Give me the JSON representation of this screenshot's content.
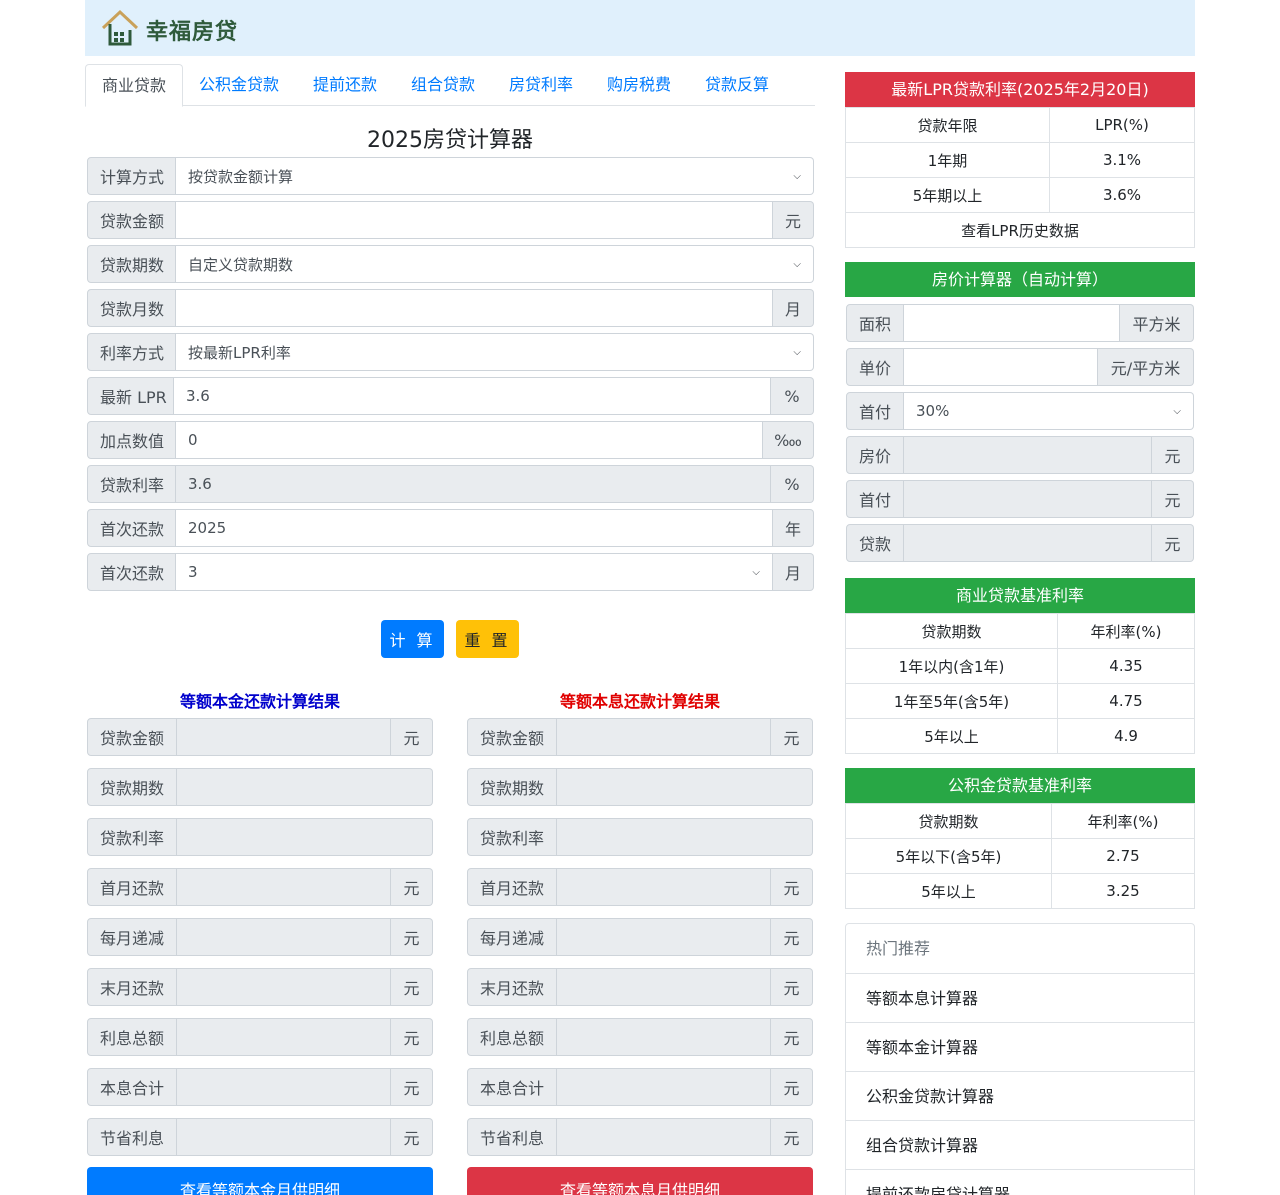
{
  "site": {
    "name": "幸福房贷"
  },
  "tabs": [
    "商业贷款",
    "公积金贷款",
    "提前还款",
    "组合贷款",
    "房贷利率",
    "购房税费",
    "贷款反算"
  ],
  "calculator": {
    "title": "2025房贷计算器",
    "rows": [
      {
        "label": "计算方式",
        "value": "按贷款金额计算",
        "unit": "",
        "kind": "select"
      },
      {
        "label": "贷款金额",
        "value": "",
        "unit": "元",
        "kind": "input"
      },
      {
        "label": "贷款期数",
        "value": "自定义贷款期数",
        "unit": "",
        "kind": "select"
      },
      {
        "label": "贷款月数",
        "value": "",
        "unit": "月",
        "kind": "input"
      },
      {
        "label": "利率方式",
        "value": "按最新LPR利率",
        "unit": "",
        "kind": "select"
      },
      {
        "label": "最新 LPR",
        "value": "3.6",
        "unit": "%",
        "kind": "input"
      },
      {
        "label": "加点数值",
        "value": "0",
        "unit": "‱",
        "kind": "input"
      },
      {
        "label": "贷款利率",
        "value": "3.6",
        "unit": "%",
        "kind": "readonly"
      },
      {
        "label": "首次还款",
        "value": "2025",
        "unit": "年",
        "kind": "input"
      },
      {
        "label": "首次还款",
        "value": "3",
        "unit": "月",
        "kind": "select"
      }
    ],
    "calc_button": "计 算",
    "reset_button": "重 置"
  },
  "results": {
    "left_title": "等额本金还款计算结果",
    "right_title": "等额本息还款计算结果",
    "rows": [
      {
        "label": "贷款金额",
        "unit": "元"
      },
      {
        "label": "贷款期数",
        "unit": ""
      },
      {
        "label": "贷款利率",
        "unit": ""
      },
      {
        "label": "首月还款",
        "unit": "元"
      },
      {
        "label": "每月递减",
        "unit": "元"
      },
      {
        "label": "末月还款",
        "unit": "元"
      },
      {
        "label": "利息总额",
        "unit": "元"
      },
      {
        "label": "本息合计",
        "unit": "元"
      },
      {
        "label": "节省利息",
        "unit": "元"
      }
    ],
    "left_button": "查看等额本金月供明细",
    "right_button": "查看等额本息月供明细"
  },
  "lpr": {
    "title": "最新LPR贷款利率(2025年2月20日)",
    "header": [
      "贷款年限",
      "LPR(%)"
    ],
    "rows": [
      [
        "1年期",
        "3.1%"
      ],
      [
        "5年期以上",
        "3.6%"
      ]
    ],
    "link": "查看LPR历史数据"
  },
  "house_price": {
    "title": "房价计算器（自动计算）",
    "rows": [
      {
        "label": "面积",
        "value": "",
        "unit": "平方米",
        "kind": "input"
      },
      {
        "label": "单价",
        "value": "",
        "unit": "元/平方米",
        "kind": "input"
      },
      {
        "label": "首付",
        "value": "30%",
        "unit": "",
        "kind": "select"
      },
      {
        "label": "房价",
        "value": "",
        "unit": "元",
        "kind": "readonly"
      },
      {
        "label": "首付",
        "value": "",
        "unit": "元",
        "kind": "readonly"
      },
      {
        "label": "贷款",
        "value": "",
        "unit": "元",
        "kind": "readonly"
      }
    ]
  },
  "commercial_rates": {
    "title": "商业贷款基准利率",
    "header": [
      "贷款期数",
      "年利率(%)"
    ],
    "rows": [
      [
        "1年以内(含1年)",
        "4.35"
      ],
      [
        "1年至5年(含5年)",
        "4.75"
      ],
      [
        "5年以上",
        "4.9"
      ]
    ]
  },
  "fund_rates": {
    "title": "公积金贷款基准利率",
    "header": [
      "贷款期数",
      "年利率(%)"
    ],
    "rows": [
      [
        "5年以下(含5年)",
        "2.75"
      ],
      [
        "5年以上",
        "3.25"
      ]
    ]
  },
  "hot": {
    "title": "热门推荐",
    "items": [
      "等额本息计算器",
      "等额本金计算器",
      "公积金贷款计算器",
      "组合贷款计算器",
      "提前还款房贷计算器"
    ]
  },
  "colors": {
    "red": "#dc3545",
    "green": "#28a745",
    "blue": "#007bff",
    "yellow": "#ffc107",
    "dark_blue": "#0000cc",
    "title_red": "#e00000"
  }
}
